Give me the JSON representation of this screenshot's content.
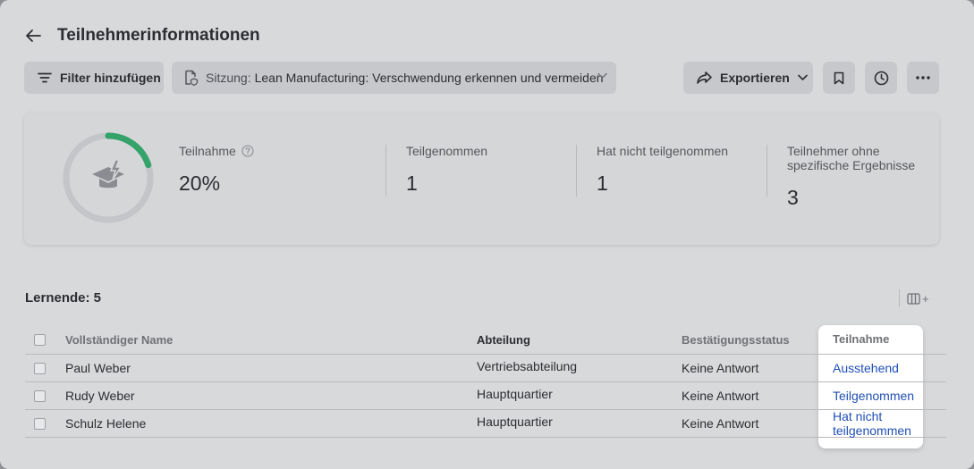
{
  "header": {
    "title": "Teilnehmerinformationen"
  },
  "toolbar": {
    "filter_label": "Filter hinzufügen",
    "session_prefix": "Sitzung:",
    "session_value": "Lean Manufacturing: Verschwendung erkennen und vermeiden",
    "export_label": "Exportieren"
  },
  "summary": {
    "participation": {
      "label": "Teilnahme",
      "value": "20%",
      "fraction": 0.2
    },
    "attended": {
      "label": "Teilgenommen",
      "value": "1"
    },
    "not_attended": {
      "label": "Hat nicht teilgenommen",
      "value": "1"
    },
    "no_result": {
      "label": "Teilnehmer ohne spezifische Ergebnisse",
      "value": "3"
    }
  },
  "learners_label": "Lernende: 5",
  "table": {
    "columns": [
      "Vollständiger Name",
      "Abteilung",
      "Bestätigungsstatus",
      "Teilnahme"
    ],
    "rows": [
      {
        "name": "Paul Weber",
        "dept": "Vertriebsabteilung",
        "status": "Keine Antwort",
        "participation": "Ausstehend"
      },
      {
        "name": "Rudy Weber",
        "dept": "Hauptquartier",
        "status": "Keine Antwort",
        "participation": "Teilgenommen"
      },
      {
        "name": "Schulz Helene",
        "dept": "Hauptquartier",
        "status": "Keine Antwort",
        "participation": "Hat nicht teilgenommen"
      }
    ]
  },
  "colors": {
    "accent_green": "#34a36a",
    "link_blue": "#1f4fb5"
  },
  "icons": [
    "back-arrow-icon",
    "filter-icon",
    "session-icon",
    "share-icon",
    "bookmark-icon",
    "clock-icon",
    "more-icon",
    "help-icon",
    "graduation-cap-icon",
    "columns-icon"
  ]
}
